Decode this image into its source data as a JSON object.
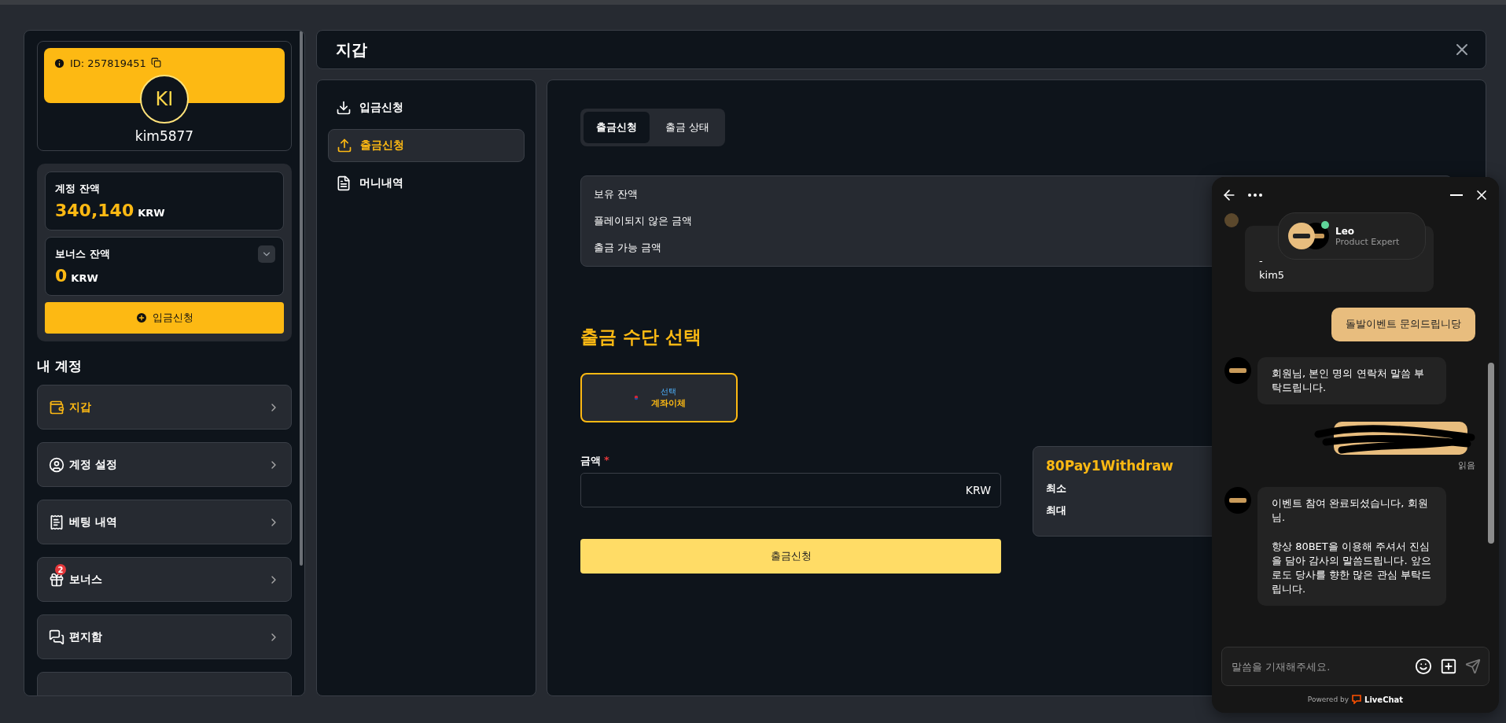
{
  "profile": {
    "id_label": "ID: 257819451",
    "avatar_initials": "KI",
    "username": "kim5877"
  },
  "balances": {
    "account": {
      "label": "계정 잔액",
      "amount": "340,140",
      "currency": "KRW"
    },
    "bonus": {
      "label": "보너스 잔액",
      "amount": "0",
      "currency": "KRW",
      "expanded": false
    },
    "deposit_button": "입금신청"
  },
  "account_menu": {
    "title": "내 계정",
    "items": [
      {
        "label": "지갑",
        "selected": true
      },
      {
        "label": "계정 설정",
        "selected": false
      },
      {
        "label": "베팅 내역",
        "selected": false
      },
      {
        "label": "보너스",
        "selected": false,
        "badge": "2"
      },
      {
        "label": "편지함",
        "selected": false
      }
    ]
  },
  "header": {
    "title": "지갑"
  },
  "wallet_nav": [
    {
      "label": "입금신청",
      "selected": false
    },
    {
      "label": "출금신청",
      "selected": true
    },
    {
      "label": "머니내역",
      "selected": false
    }
  ],
  "tabs": [
    {
      "label": "출금신청",
      "selected": true
    },
    {
      "label": "출금 상태",
      "selected": false
    }
  ],
  "balance_summary": [
    "보유 잔액",
    "플레이되지 않은 금액",
    "출금 가능 금액"
  ],
  "method_heading": "출금 수단 선택",
  "methods": [
    {
      "tag": "선택",
      "label": "계좌이체",
      "selected": true
    }
  ],
  "amount": {
    "label": "금액",
    "required_mark": "*",
    "currency": "KRW"
  },
  "submit_button": "출금신청",
  "limits": {
    "title": "80Pay1Withdraw",
    "rows": [
      "최소",
      "최대"
    ]
  },
  "chat": {
    "agent": {
      "name": "Leo",
      "role": "Product Expert",
      "online": true
    },
    "messages": [
      {
        "kind": "agent",
        "text": "-\nkim5"
      },
      {
        "kind": "visitor",
        "text": "돌발이벤트 문의드립니당"
      },
      {
        "kind": "agent",
        "text": "회원님, 본인 명의 연락처 말씀 부탁드립니다."
      },
      {
        "kind": "redacted",
        "status": "읽음"
      },
      {
        "kind": "agent",
        "text": "이벤트 참여 완료되셨습니다, 회원님.\n\n항상 80BET을 이용해 주셔서 진심을 담아 감사의 말씀드립니다. 앞으로도 당사를 향한 많은 관심 부탁드립니다."
      }
    ],
    "input_placeholder": "말씀을 기재해주세요.",
    "powered_by": "Powered by",
    "brand": "LiveChat"
  }
}
